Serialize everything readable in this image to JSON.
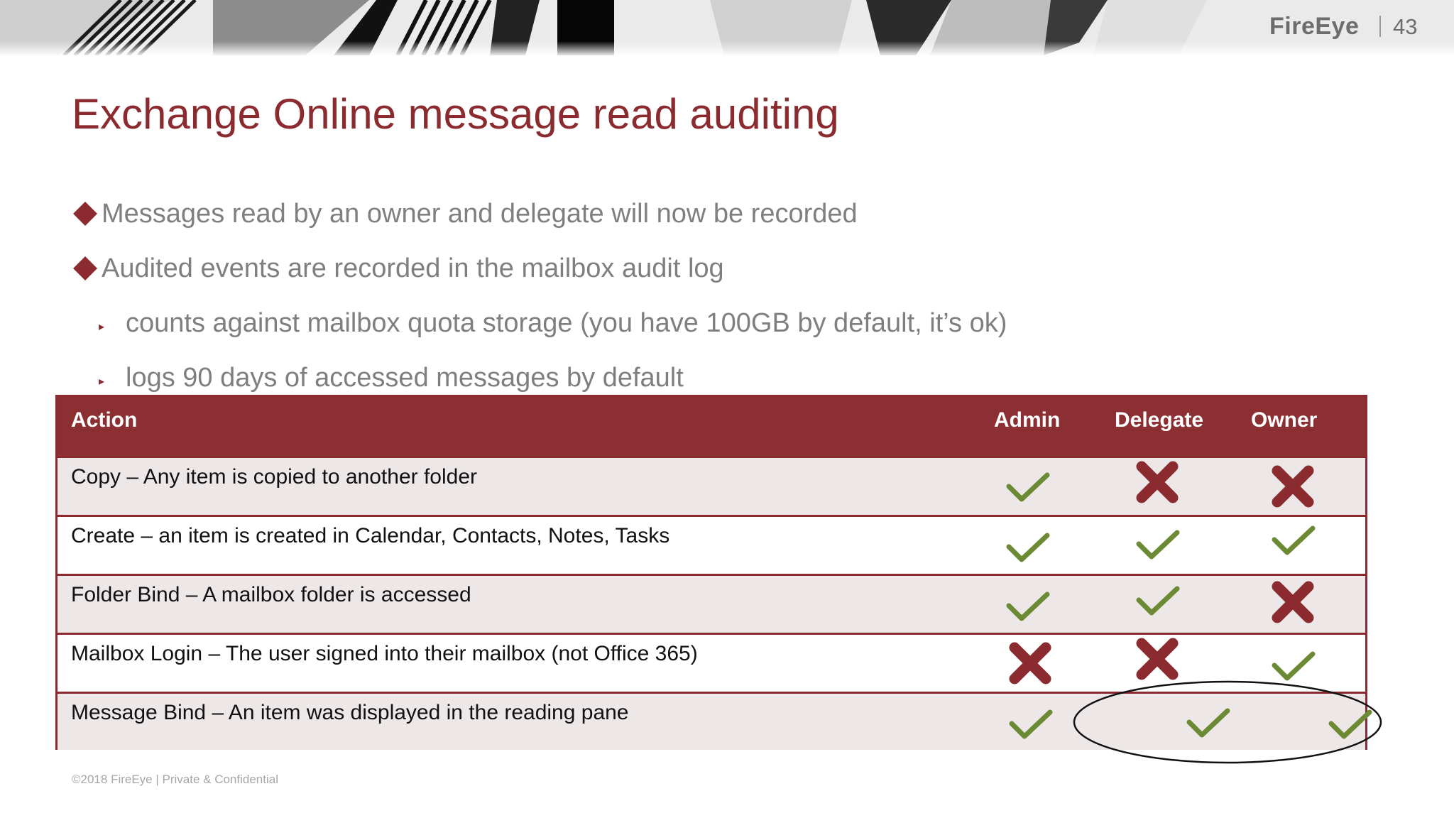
{
  "header": {
    "brand": "FireEye",
    "page_number": "43"
  },
  "slide": {
    "title": "Exchange Online message read auditing",
    "bullets": [
      "Messages read by an owner and delegate will now be recorded",
      "Audited events are recorded in the mailbox audit log"
    ],
    "sub_bullets": [
      "counts against mailbox quota storage (you have 100GB by default, it’s ok)",
      "logs 90 days of accessed messages by default"
    ]
  },
  "table": {
    "headers": [
      "Action",
      "Admin",
      "Delegate",
      "Owner"
    ],
    "rows": [
      {
        "action": "Copy – Any item is copied to another folder",
        "admin": "check",
        "delegate": "cross",
        "owner": "cross"
      },
      {
        "action": "Create – an item is created in Calendar, Contacts, Notes, Tasks",
        "admin": "check",
        "delegate": "check",
        "owner": "check"
      },
      {
        "action": "Folder Bind – A mailbox folder is accessed",
        "admin": "check",
        "delegate": "check",
        "owner": "cross"
      },
      {
        "action": "Mailbox Login – The user signed into their mailbox (not Office 365)",
        "admin": "cross",
        "delegate": "cross",
        "owner": "check"
      },
      {
        "action": "Message Bind – An item was displayed in the reading pane",
        "admin": "check",
        "delegate": "check",
        "owner": "check"
      }
    ]
  },
  "footer": {
    "text": "©2018 FireEye  |  Private & Confidential"
  },
  "colors": {
    "accent": "#8b2b2f",
    "check": "#6b8a33",
    "cross": "#8b2b2f",
    "body_text": "#7f7f7f"
  }
}
